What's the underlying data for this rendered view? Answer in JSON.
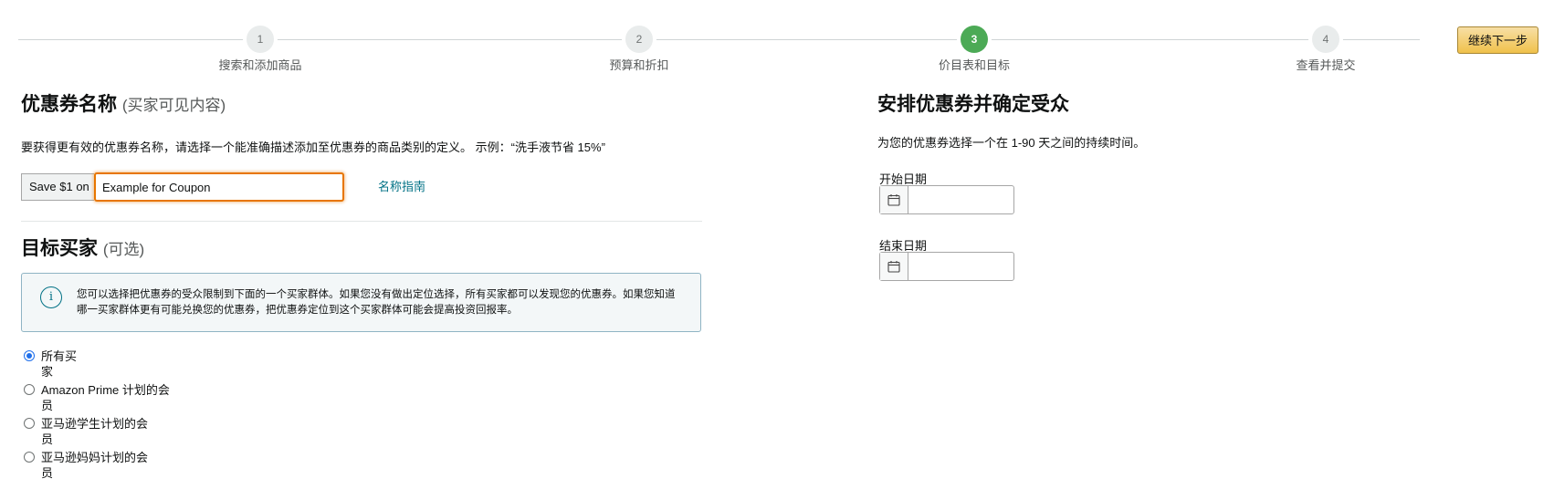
{
  "stepper": {
    "steps": [
      {
        "number": "1",
        "label": "搜索和添加商品"
      },
      {
        "number": "2",
        "label": "预算和折扣"
      },
      {
        "number": "3",
        "label": "价目表和目标"
      },
      {
        "number": "4",
        "label": "查看并提交"
      }
    ],
    "active_step": 3,
    "continue_label": "继续下一步"
  },
  "coupon_name": {
    "title": "优惠券名称",
    "subtitle": "(买家可见内容)",
    "description": "要获得更有效的优惠券名称，请选择一个能准确描述添加至优惠券的商品类别的定义。 示例：“洗手液节省 15%”",
    "prefix": "Save $1 on",
    "value": "Example for Coupon",
    "guide_link": "名称指南"
  },
  "target_buyers": {
    "title": "目标买家",
    "subtitle": "(可选)",
    "info_icon": "info-icon",
    "info_text": "您可以选择把优惠券的受众限制到下面的一个买家群体。如果您没有做出定位选择，所有买家都可以发现您的优惠券。如果您知道哪一买家群体更有可能兑换您的优惠券，把优惠券定位到这个买家群体可能会提高投资回报率。",
    "options": [
      {
        "label": "所有买家",
        "checked": true
      },
      {
        "label": "Amazon Prime 计划的会员",
        "checked": false
      },
      {
        "label": "亚马逊学生计划的会员",
        "checked": false
      },
      {
        "label": "亚马逊妈妈计划的会员",
        "checked": false
      }
    ]
  },
  "schedule": {
    "title": "安排优惠券并确定受众",
    "description": "为您的优惠券选择一个在 1-90 天之间的持续时间。",
    "start_label": "开始日期",
    "start_value": "",
    "end_label": "结束日期",
    "end_value": "",
    "calendar_icon": "calendar-icon"
  },
  "colors": {
    "accent_orange": "#e77600",
    "link": "#007185",
    "active_step": "#4caa56",
    "button": "#f0c14b"
  }
}
